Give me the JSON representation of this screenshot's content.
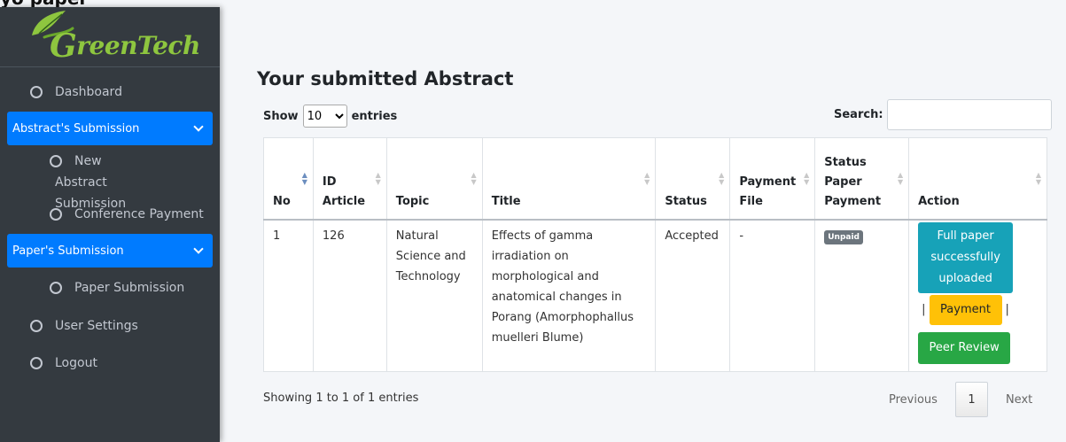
{
  "cropped_heading": "yo   paper",
  "brand": {
    "name": "GreenTech",
    "accent": "#8ec63f"
  },
  "sidebar": {
    "items": [
      {
        "label": "Dashboard"
      },
      {
        "label": "Abstract's Submission"
      },
      {
        "label": "New Abstract Submission"
      },
      {
        "label": "Conference Payment"
      },
      {
        "label": "Paper's Submission"
      },
      {
        "label": "Paper Submission"
      },
      {
        "label": "User Settings"
      },
      {
        "label": "Logout"
      }
    ]
  },
  "main": {
    "title": "Your submitted Abstract",
    "show_label": "Show",
    "entries_value": "10",
    "entries_label": "entries",
    "search_label": "Search:",
    "search_value": ""
  },
  "table": {
    "headers": [
      "No",
      "ID Article",
      "Topic",
      "Title",
      "Status",
      "Payment File",
      "Status Paper Payment",
      "Action"
    ],
    "rows": [
      {
        "no": "1",
        "id": "126",
        "topic": "Natural Science and Technology",
        "title": "Effects of gamma irradiation on morphological and anatomical changes in Porang (Amorphophallus muelleri Blume)",
        "status": "Accepted",
        "payment_file": "-",
        "payment_status": "Unpaid",
        "actions": {
          "full_paper": "Full paper successfully uploaded",
          "payment": "Payment",
          "peer_review": "Peer Review"
        }
      }
    ]
  },
  "footer": {
    "info": "Showing 1 to 1 of 1 entries",
    "previous": "Previous",
    "page": "1",
    "next": "Next"
  }
}
